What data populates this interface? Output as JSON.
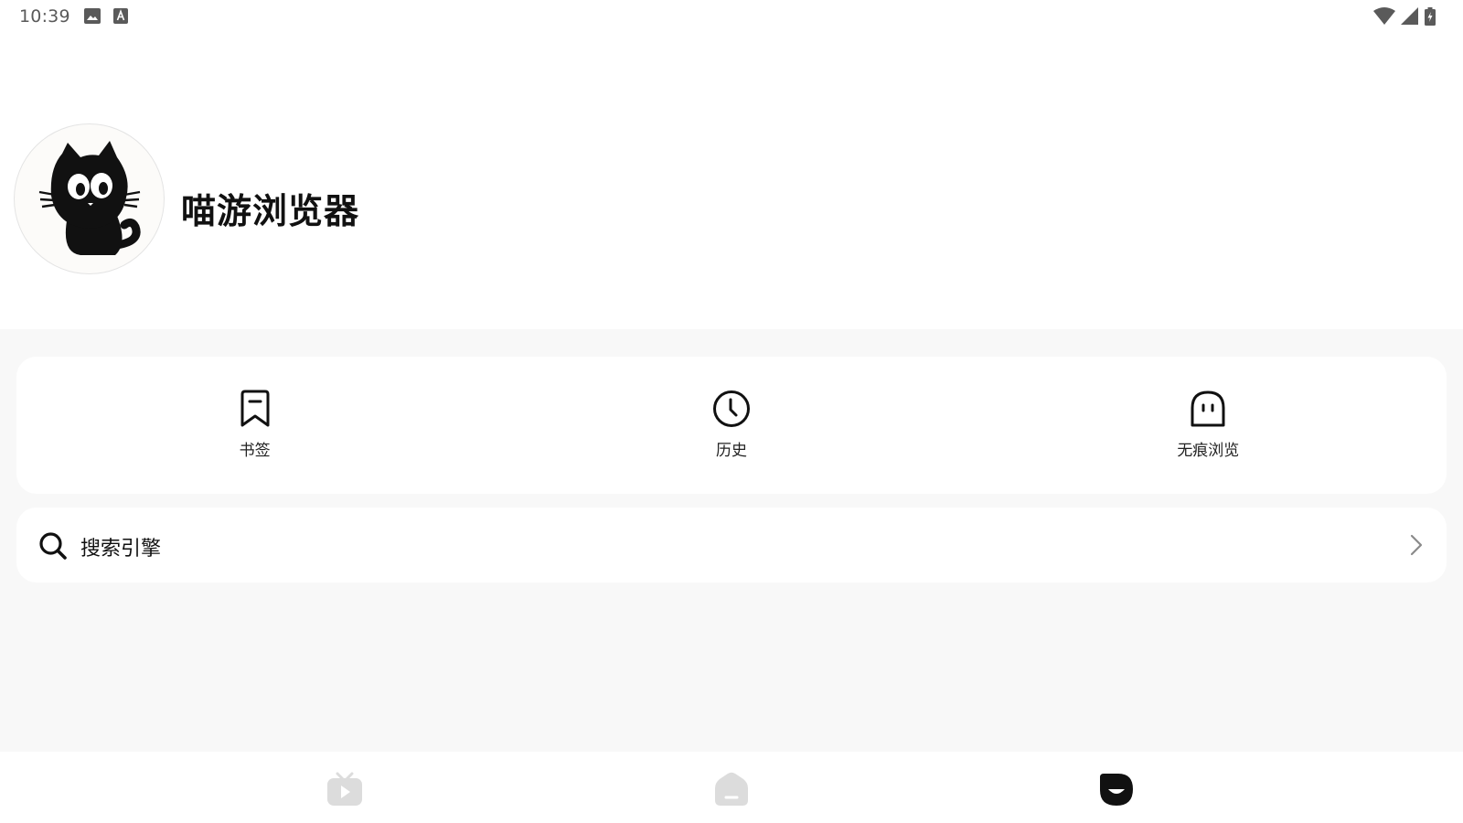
{
  "status_bar": {
    "time": "10:39",
    "left_icons": [
      "image-icon",
      "font-icon"
    ],
    "right_icons": [
      "wifi-icon",
      "cellular-signal-icon",
      "battery-charging-icon"
    ]
  },
  "profile": {
    "avatar_icon": "cat-avatar-icon",
    "app_name": "喵游浏览器"
  },
  "quick_actions": [
    {
      "icon": "bookmark-icon",
      "label": "书签"
    },
    {
      "icon": "clock-icon",
      "label": "历史"
    },
    {
      "icon": "ghost-icon",
      "label": "无痕浏览"
    }
  ],
  "settings": {
    "search_engine": {
      "icon": "search-icon",
      "label": "搜索引擎",
      "trailing_icon": "chevron-right-icon"
    }
  },
  "bottom_nav": [
    {
      "icon": "video-tv-icon",
      "active": false
    },
    {
      "icon": "home-icon",
      "active": false
    },
    {
      "icon": "mine-icon",
      "active": true
    }
  ],
  "colors": {
    "background": "#ffffff",
    "content_background": "#f8f8f8",
    "text_primary": "#111111",
    "nav_inactive": "#dddddd",
    "nav_active": "#111111"
  }
}
